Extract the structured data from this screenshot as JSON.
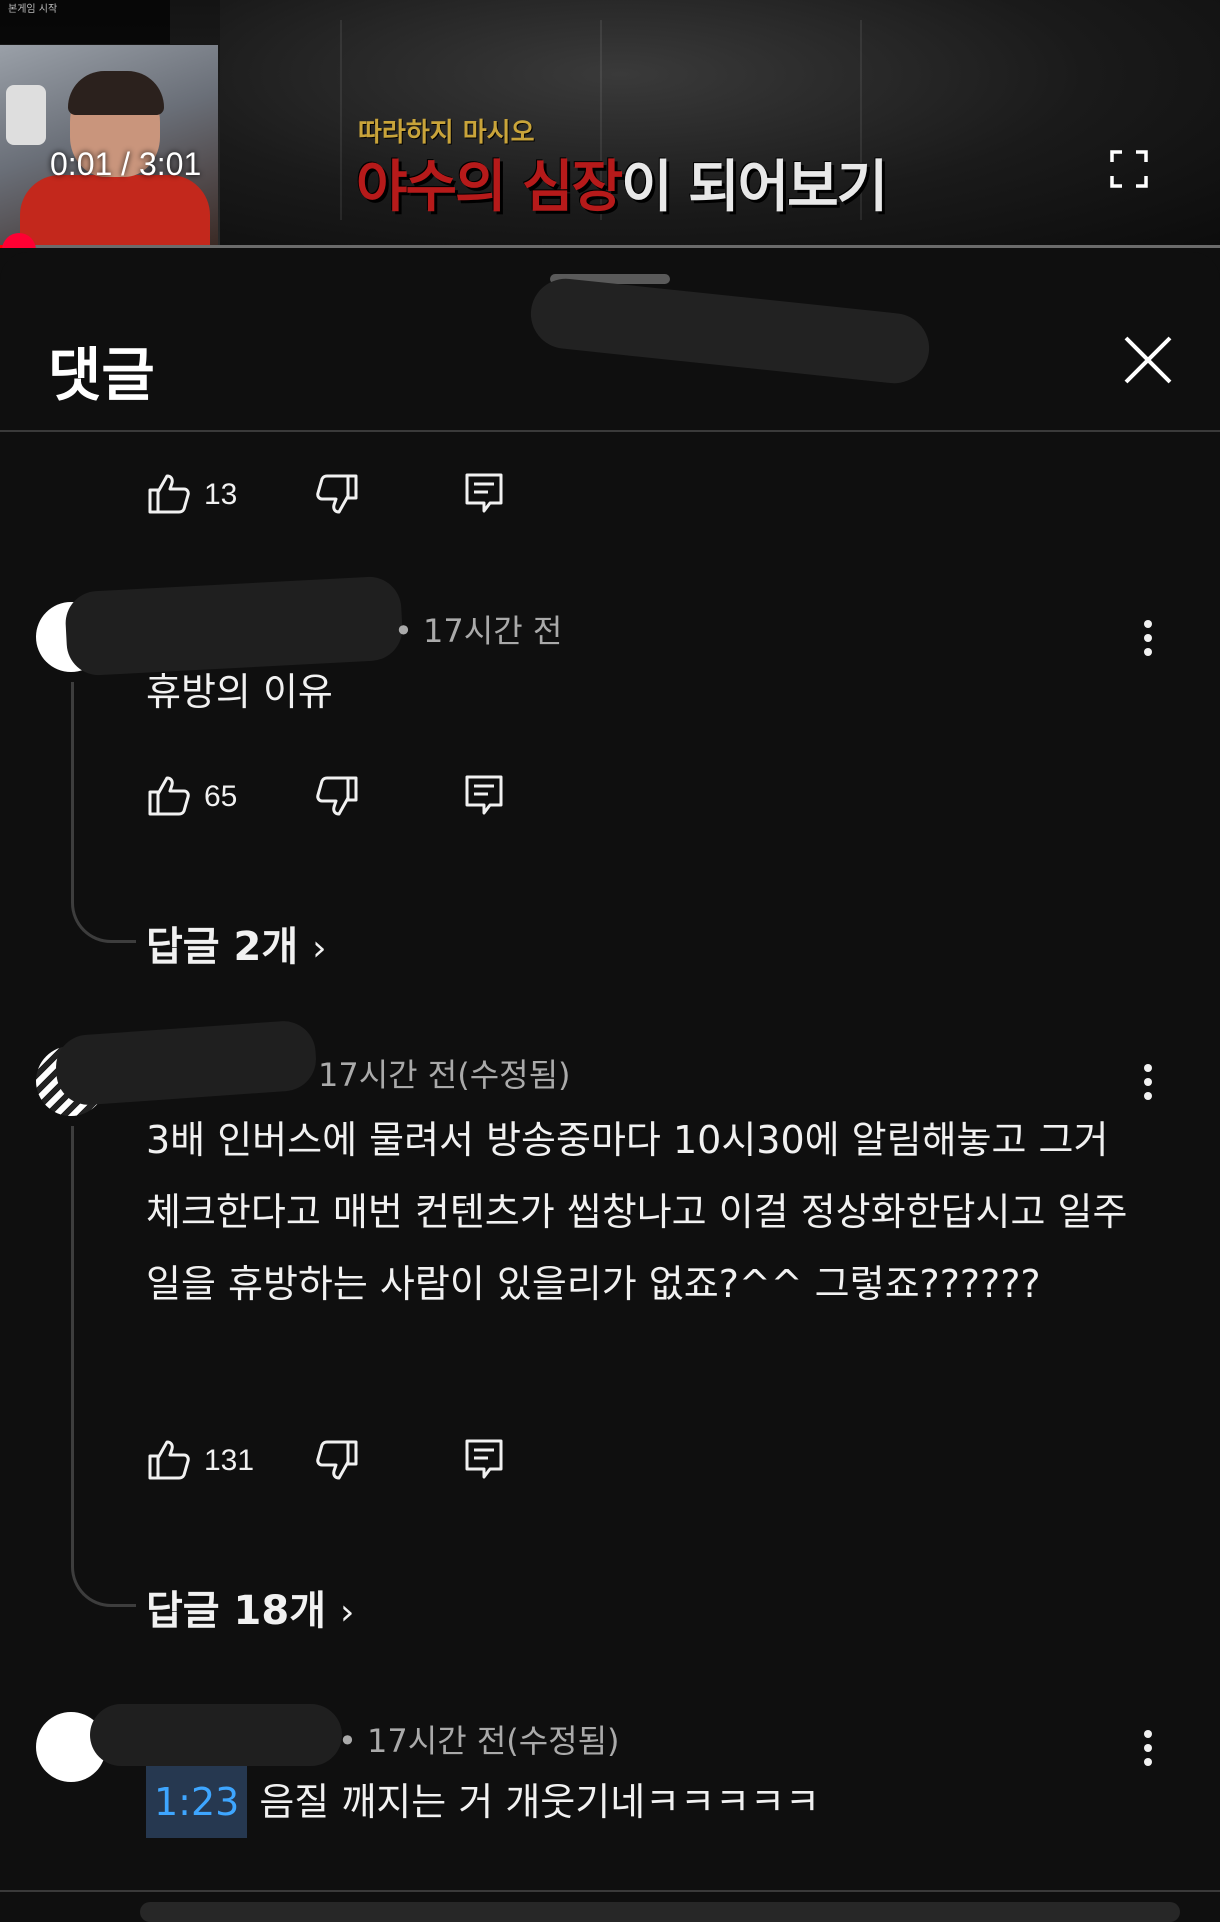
{
  "player": {
    "time_display": "0:01 / 3:01",
    "overlay_line1": "",
    "overlay_line2": "본게임 시작",
    "caption_small": "따라하지 마시오",
    "caption_big_red": "야수의 심장",
    "caption_big_white": "이 되어보기",
    "progress": 0.0055,
    "accent_color": "#ff0033"
  },
  "sheet": {
    "title": "댓글",
    "close_icon": "close-icon"
  },
  "comments": [
    {
      "likes": "13",
      "actions_only": true
    },
    {
      "meta": "• 17시간 전",
      "text": "휴방의 이유",
      "likes": "65",
      "replies": "답글 2개"
    },
    {
      "meta": "17시간 전(수정됨)",
      "text": "3배 인버스에 물려서 방송중마다 10시30에 알림해놓고 그거 체크한다고 매번 컨텐츠가 씹창나고 이걸 정상화한답시고 일주일을 휴방하는 사람이 있을리가 없죠?^^ 그렇죠??????",
      "likes": "131",
      "replies": "답글 18개"
    },
    {
      "meta": "• 17시간 전(수정됨)",
      "timestamp": "1:23",
      "text": "음질 깨지는 거 개웃기네ㅋㅋㅋㅋㅋ"
    }
  ],
  "colors": {
    "background": "#0f0f0f",
    "text": "#f1f1f1",
    "meta": "#aaaaaa",
    "link": "#3ea6ff"
  }
}
